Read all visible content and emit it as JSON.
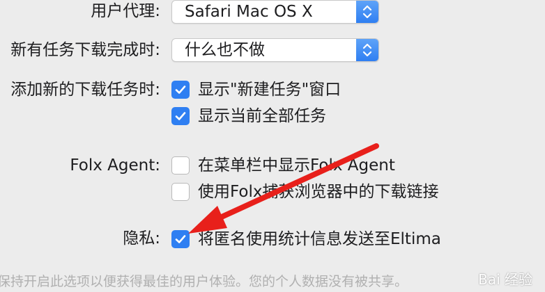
{
  "rows": {
    "user_agent": {
      "label": "用户代理:",
      "value": "Safari Mac OS X"
    },
    "on_complete": {
      "label": "新有任务下载完成时:",
      "value": "什么也不做"
    },
    "on_add": {
      "label": "添加新的下载任务时:",
      "options": [
        {
          "text": "显示\"新建任务\"窗口",
          "checked": true
        },
        {
          "text": "显示当前全部任务",
          "checked": true
        }
      ]
    },
    "folx_agent": {
      "label": "Folx Agent:",
      "options": [
        {
          "text": "在菜单栏中显示Folx Agent",
          "checked": false
        },
        {
          "text": "使用Folx捕获浏览器中的下载链接",
          "checked": false
        }
      ]
    },
    "privacy": {
      "label": "隐私:",
      "options": [
        {
          "text": "将匿名使用统计信息发送至Eltima",
          "checked": true
        }
      ]
    }
  },
  "footer": "保持开启此选项以便获得最佳的用户体验。您的个人数据没有被共享。",
  "watermark": "Bai 经验",
  "colors": {
    "accent": "#2f7ff2",
    "arrow": "#e8201b",
    "background": "#ececec"
  }
}
